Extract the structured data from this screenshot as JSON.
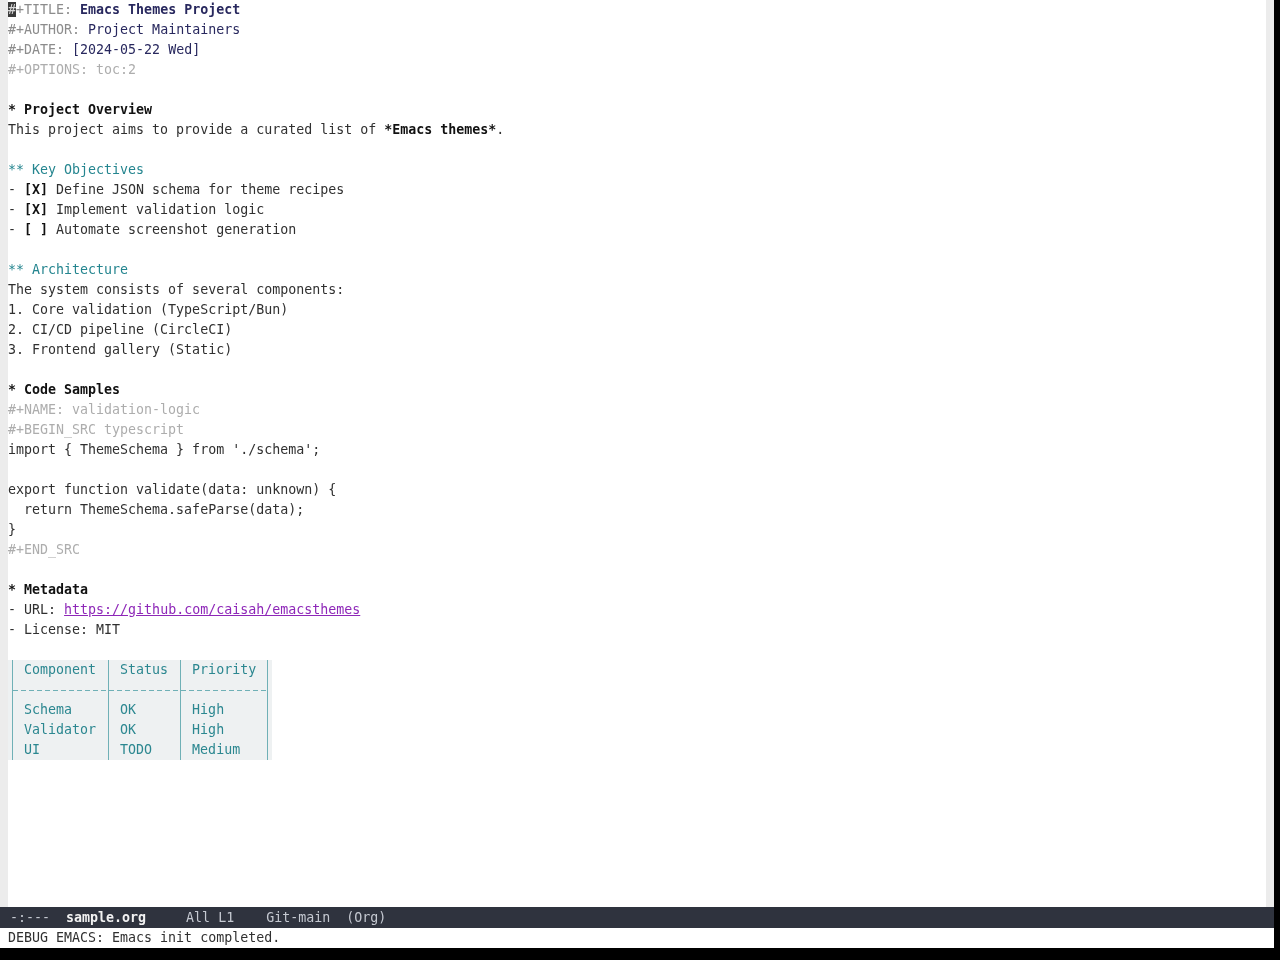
{
  "editor": {
    "keywords": [
      {
        "key": "#+TITLE:",
        "value": "Emacs Themes Project",
        "kind": "title",
        "cursor": true
      },
      {
        "key": "#+AUTHOR:",
        "value": "Project Maintainers",
        "kind": "author",
        "cursor": false
      },
      {
        "key": "#+DATE:",
        "value": "[2024-05-22 Wed]",
        "kind": "date",
        "cursor": false
      },
      {
        "key": "#+OPTIONS:",
        "value": "toc:2",
        "kind": "option",
        "cursor": false
      }
    ],
    "sections": [
      {
        "heading": "* Project Overview",
        "body": [
          {
            "kind": "paragraph",
            "segments": [
              {
                "text": "This project aims to provide a curated list of ",
                "kind": "plain"
              },
              {
                "text": "*Emacs themes*",
                "kind": "bold"
              },
              {
                "text": ".",
                "kind": "plain"
              }
            ]
          }
        ],
        "subsections": [
          {
            "heading": "** Key Objectives",
            "body": [
              {
                "kind": "checklist",
                "items": [
                  "- **[X]** Define JSON schema for theme recipes",
                  "- **[X]** Implement validation logic",
                  "- **[ ]** Automate screenshot generation"
                ]
              }
            ]
          },
          {
            "heading": "** Architecture",
            "body": [
              {
                "kind": "paragraph",
                "segments": [
                  {
                    "text": "The system consists of several components:",
                    "kind": "plain"
                  }
                ]
              },
              {
                "kind": "ordered_list",
                "items": [
                  "1. Core validation (TypeScript/Bun)",
                  "2. CI/CD pipeline (CircleCI)",
                  "3. Frontend gallery (Static)"
                ]
              }
            ]
          }
        ]
      },
      {
        "heading": "* Code Samples",
        "body": [
          {
            "kind": "meta",
            "text": "#+NAME: validation-logic"
          },
          {
            "kind": "src_block",
            "begin": "#+BEGIN_SRC typescript",
            "code": "import { ThemeSchema } from './schema';\n\nexport function validate(data: unknown) {\n  return ThemeSchema.safeParse(data);\n}",
            "end": "#+END_SRC"
          }
        ]
      },
      {
        "heading": "* Metadata",
        "body": [
          {
            "kind": "list",
            "items": [
              {
                "text": "- URL:",
                "link": "https://github.com/caisah/emacsthemes"
              },
              {
                "text": "- License: MIT"
              }
            ]
          },
          {
            "kind": "table",
            "columns": [
              "Component",
              "Status",
              "Priority"
            ],
            "rows": [
              [
                "Schema",
                "OK",
                "High"
              ],
              [
                "Validator",
                "OK",
                "High"
              ],
              [
                "UI",
                "TODO",
                "Medium"
              ]
            ]
          }
        ]
      }
    ]
  },
  "mode_line": {
    "state": "-:---",
    "buffer": "sample.org",
    "position": "All L1",
    "branch": "Git-main",
    "mode": "(Org)"
  },
  "echo_area": {
    "message": "DEBUG EMACS: Emacs init completed."
  }
}
